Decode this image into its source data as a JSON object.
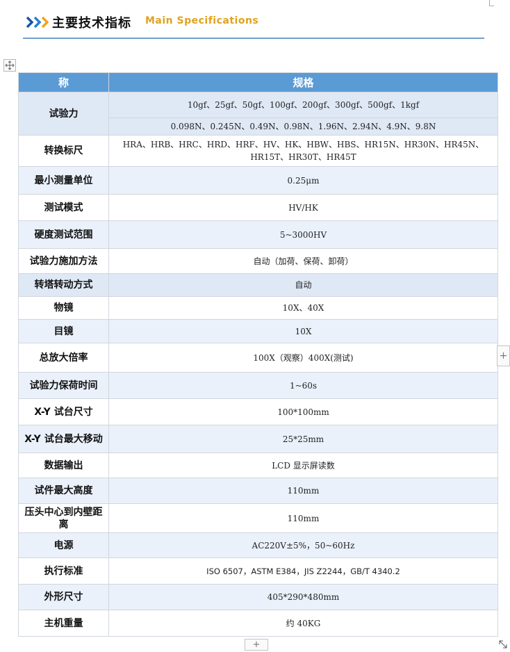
{
  "header": {
    "title_cn": "主要技术指标",
    "title_en": "Main Specifications",
    "chevron_colors": [
      "#1a56a8",
      "#2a7fd0",
      "#f0a31e"
    ],
    "accent_color": "#e0a21e"
  },
  "table": {
    "header_name": "称",
    "header_spec": "规格",
    "rows": [
      {
        "name": "试验力",
        "values": [
          "10gf、25gf、50gf、100gf、200gf、300gf、500gf、1kgf",
          "0.098N、0.245N、0.49N、0.98N、1.96N、2.94N、4.9N、9.8N"
        ]
      },
      {
        "name": "转换标尺",
        "value": "HRA、HRB、HRC、HRD、HRF、HV、HK、HBW、HBS、HR15N、HR30N、HR45N、HR15T、HR30T、HR45T"
      },
      {
        "name": "最小测量单位",
        "value": "0.25μm"
      },
      {
        "name": "测试模式",
        "value": "HV/HK"
      },
      {
        "name": "硬度测试范围",
        "value": "5~3000HV"
      },
      {
        "name": "试验力施加方法",
        "value": "自动（加荷、保荷、卸荷）"
      },
      {
        "name": "转塔转动方式",
        "value": "自动"
      },
      {
        "name": "物镜",
        "value": "10X、40X"
      },
      {
        "name": "目镜",
        "value": "10X"
      },
      {
        "name": "总放大倍率",
        "value": "100X（观察）400X(测试)"
      },
      {
        "name": "试验力保荷时间",
        "value": "1~60s"
      },
      {
        "name": "X-Y 试台尺寸",
        "value": "100*100mm"
      },
      {
        "name": "X-Y 试台最大移动",
        "value": "25*25mm"
      },
      {
        "name": "数据输出",
        "value": "LCD 显示屏读数"
      },
      {
        "name": "试件最大高度",
        "value": "110mm"
      },
      {
        "name": "压头中心到内壁距离",
        "value": "110mm"
      },
      {
        "name": "电源",
        "value": "AC220V±5%，50~60Hz"
      },
      {
        "name": "执行标准",
        "value": "ISO 6507，ASTM E384，JIS Z2244，GB/T 4340.2"
      },
      {
        "name": "外形尺寸",
        "value": "405*290*480mm"
      },
      {
        "name": "主机重量",
        "value": "约 40KG"
      }
    ]
  },
  "controls": {
    "add_column": "+",
    "add_row": "+"
  }
}
